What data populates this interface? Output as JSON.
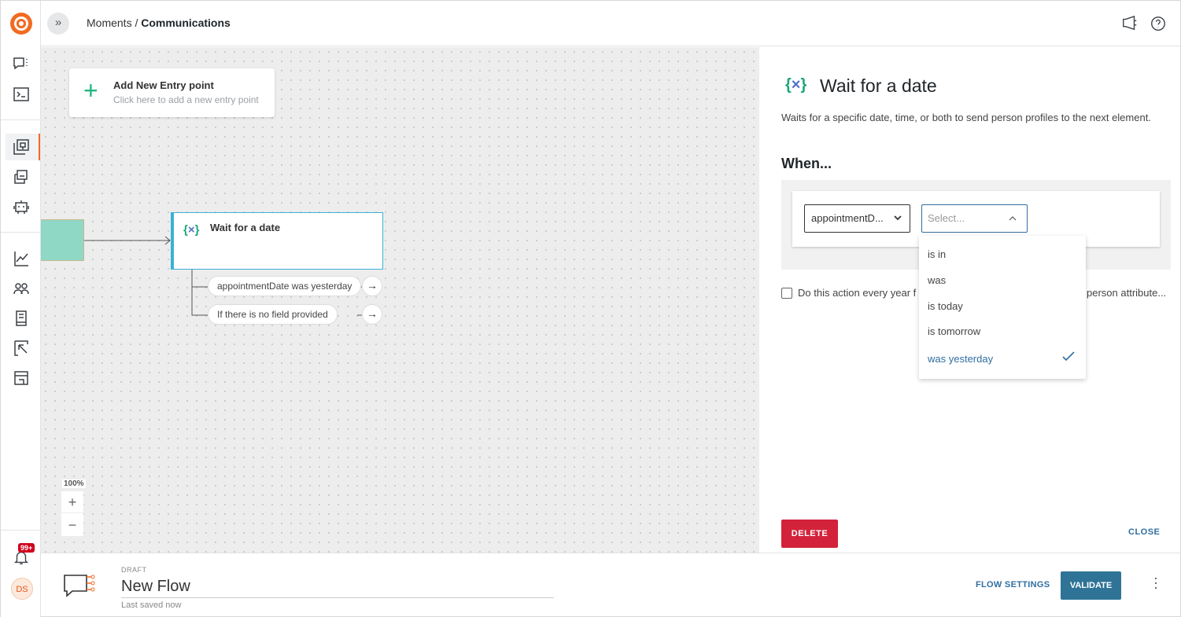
{
  "header": {
    "breadcrumb_parent": "Moments",
    "breadcrumb_separator": "/",
    "breadcrumb_current": "Communications"
  },
  "sidebar": {
    "notifications_badge": "99+",
    "user_initials": "DS",
    "icons": [
      "chat-icon",
      "terminal-icon",
      "flow-icon",
      "templates-icon",
      "robot-icon",
      "analytics-icon",
      "people-icon",
      "library-icon",
      "export-icon",
      "store-icon"
    ]
  },
  "canvas": {
    "entry_point": {
      "title": "Add New Entry point",
      "subtitle": "Click here to add a new entry point"
    },
    "wait_node": {
      "icon_left": "{",
      "icon_x": "×",
      "icon_right": "}",
      "title": "Wait for a date"
    },
    "branches": [
      {
        "label": "appointmentDate was yesterday",
        "arrow": "→"
      },
      {
        "label": "If there is no field provided",
        "arrow": "→"
      }
    ],
    "zoom": {
      "level": "100%",
      "in": "+",
      "out": "−"
    }
  },
  "panel": {
    "title": "Wait for a date",
    "description": "Waits for a specific date, time, or both to send person profiles to the next element.",
    "when_label": "When...",
    "attribute_select": "appointmentD...",
    "operator_placeholder": "Select...",
    "repeat_label_start": "Do this action every year f",
    "repeat_label_end": "person attribute...",
    "options": [
      {
        "label": "is in",
        "selected": false
      },
      {
        "label": "was",
        "selected": false
      },
      {
        "label": "is today",
        "selected": false
      },
      {
        "label": "is tomorrow",
        "selected": false
      },
      {
        "label": "was yesterday",
        "selected": true
      }
    ],
    "delete_label": "DELETE",
    "close_label": "CLOSE"
  },
  "footer": {
    "status": "DRAFT",
    "flow_name": "New Flow",
    "saved_text": "Last saved now",
    "settings_label": "FLOW SETTINGS",
    "validate_label": "VALIDATE"
  },
  "colors": {
    "brand": "#f26b21",
    "accent": "#2f6ea1",
    "danger": "#d2233b",
    "node_border": "#38b2d6",
    "teal": "#8fd8c6"
  }
}
